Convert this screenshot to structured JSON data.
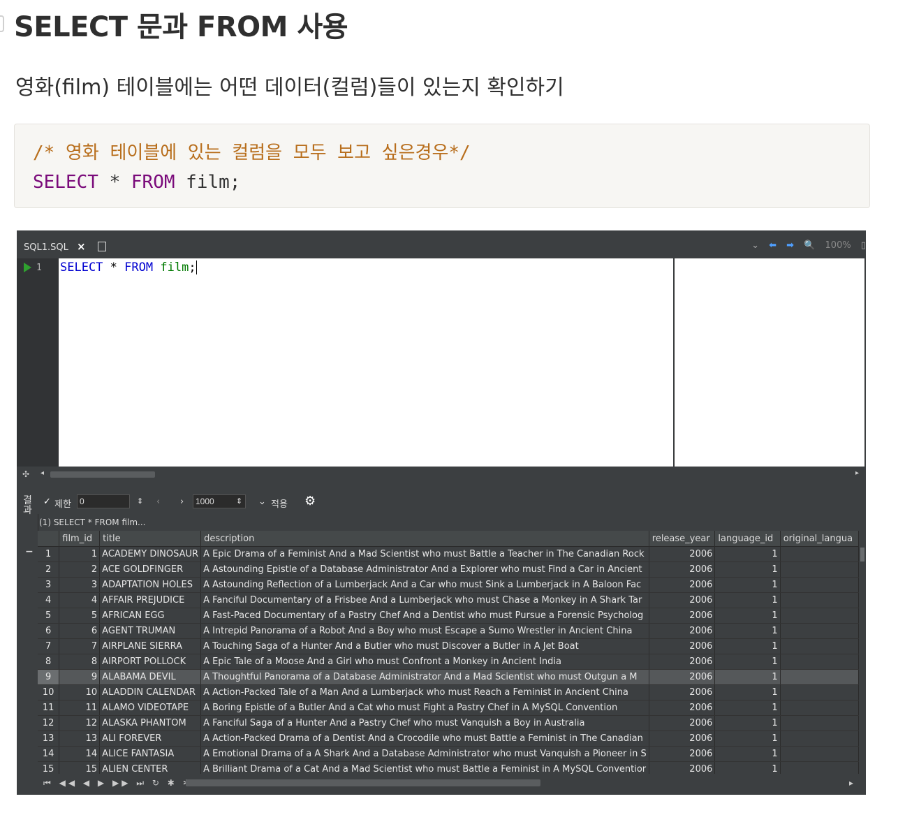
{
  "heading": "SELECT 문과 FROM 사용",
  "subtitle": "영화(film) 테이블에는 어떤 데이터(컬럼)들이 있는지 확인하기",
  "code": {
    "comment": "/* 영화 테이블에 있는 컬럼을 모두 보고 싶은경우*/",
    "kw_select": "SELECT",
    "star": "*",
    "kw_from": "FROM",
    "table": "film;"
  },
  "ide": {
    "tab_label": "SQL1.SQL",
    "tab_close": "×",
    "zoom": "100%",
    "line_number": "1",
    "editor_select": "SELECT",
    "editor_star": "*",
    "editor_from": "FROM",
    "editor_table": "film",
    "editor_semicolon": ";",
    "result_side_label": "결과",
    "toolbar": {
      "limit_label": "제한",
      "offset_value": "0",
      "limit_value": "1000",
      "apply_label": "적용"
    },
    "query_label": "(1) SELECT * FROM film...",
    "columns": [
      "",
      "film_id",
      "title",
      "description",
      "release_year",
      "language_id",
      "original_langua"
    ],
    "rows": [
      [
        "1",
        "1",
        "ACADEMY DINOSAUR",
        "A Epic Drama of a Feminist And a Mad Scientist who must Battle a Teacher in The Canadian Rock",
        "2006",
        "1",
        ""
      ],
      [
        "2",
        "2",
        "ACE GOLDFINGER",
        "A Astounding Epistle of a Database Administrator And a Explorer who must Find a Car in Ancient",
        "2006",
        "1",
        ""
      ],
      [
        "3",
        "3",
        "ADAPTATION HOLES",
        "A Astounding Reflection of a Lumberjack And a Car who must Sink a Lumberjack in A Baloon Fac",
        "2006",
        "1",
        ""
      ],
      [
        "4",
        "4",
        "AFFAIR PREJUDICE",
        "A Fanciful Documentary of a Frisbee And a Lumberjack who must Chase a Monkey in A Shark Tar",
        "2006",
        "1",
        ""
      ],
      [
        "5",
        "5",
        "AFRICAN EGG",
        "A Fast-Paced Documentary of a Pastry Chef And a Dentist who must Pursue a Forensic Psycholog",
        "2006",
        "1",
        ""
      ],
      [
        "6",
        "6",
        "AGENT TRUMAN",
        "A Intrepid Panorama of a Robot And a Boy who must Escape a Sumo Wrestler in Ancient China",
        "2006",
        "1",
        ""
      ],
      [
        "7",
        "7",
        "AIRPLANE SIERRA",
        "A Touching Saga of a Hunter And a Butler who must Discover a Butler in A Jet Boat",
        "2006",
        "1",
        ""
      ],
      [
        "8",
        "8",
        "AIRPORT POLLOCK",
        "A Epic Tale of a Moose And a Girl who must Confront a Monkey in Ancient India",
        "2006",
        "1",
        ""
      ],
      [
        "9",
        "9",
        "ALABAMA DEVIL",
        "A Thoughtful Panorama of a Database Administrator And a Mad Scientist who must Outgun a M",
        "2006",
        "1",
        ""
      ],
      [
        "10",
        "10",
        "ALADDIN CALENDAR",
        "A Action-Packed Tale of a Man And a Lumberjack who must Reach a Feminist in Ancient China",
        "2006",
        "1",
        ""
      ],
      [
        "11",
        "11",
        "ALAMO VIDEOTAPE",
        "A Boring Epistle of a Butler And a Cat who must Fight a Pastry Chef in A MySQL Convention",
        "2006",
        "1",
        ""
      ],
      [
        "12",
        "12",
        "ALASKA PHANTOM",
        "A Fanciful Saga of a Hunter And a Pastry Chef who must Vanquish a Boy in Australia",
        "2006",
        "1",
        ""
      ],
      [
        "13",
        "13",
        "ALI FOREVER",
        "A Action-Packed Drama of a Dentist And a Crocodile who must Battle a Feminist in The Canadian",
        "2006",
        "1",
        ""
      ],
      [
        "14",
        "14",
        "ALICE FANTASIA",
        "A Emotional Drama of a A Shark And a Database Administrator who must Vanquish a Pioneer in S",
        "2006",
        "1",
        ""
      ],
      [
        "15",
        "15",
        "ALIEN CENTER",
        "A Brilliant Drama of a Cat And a Mad Scientist who must Battle a Feminist in A MySQL Conventior",
        "2006",
        "1",
        ""
      ]
    ],
    "selected_row": 9
  }
}
